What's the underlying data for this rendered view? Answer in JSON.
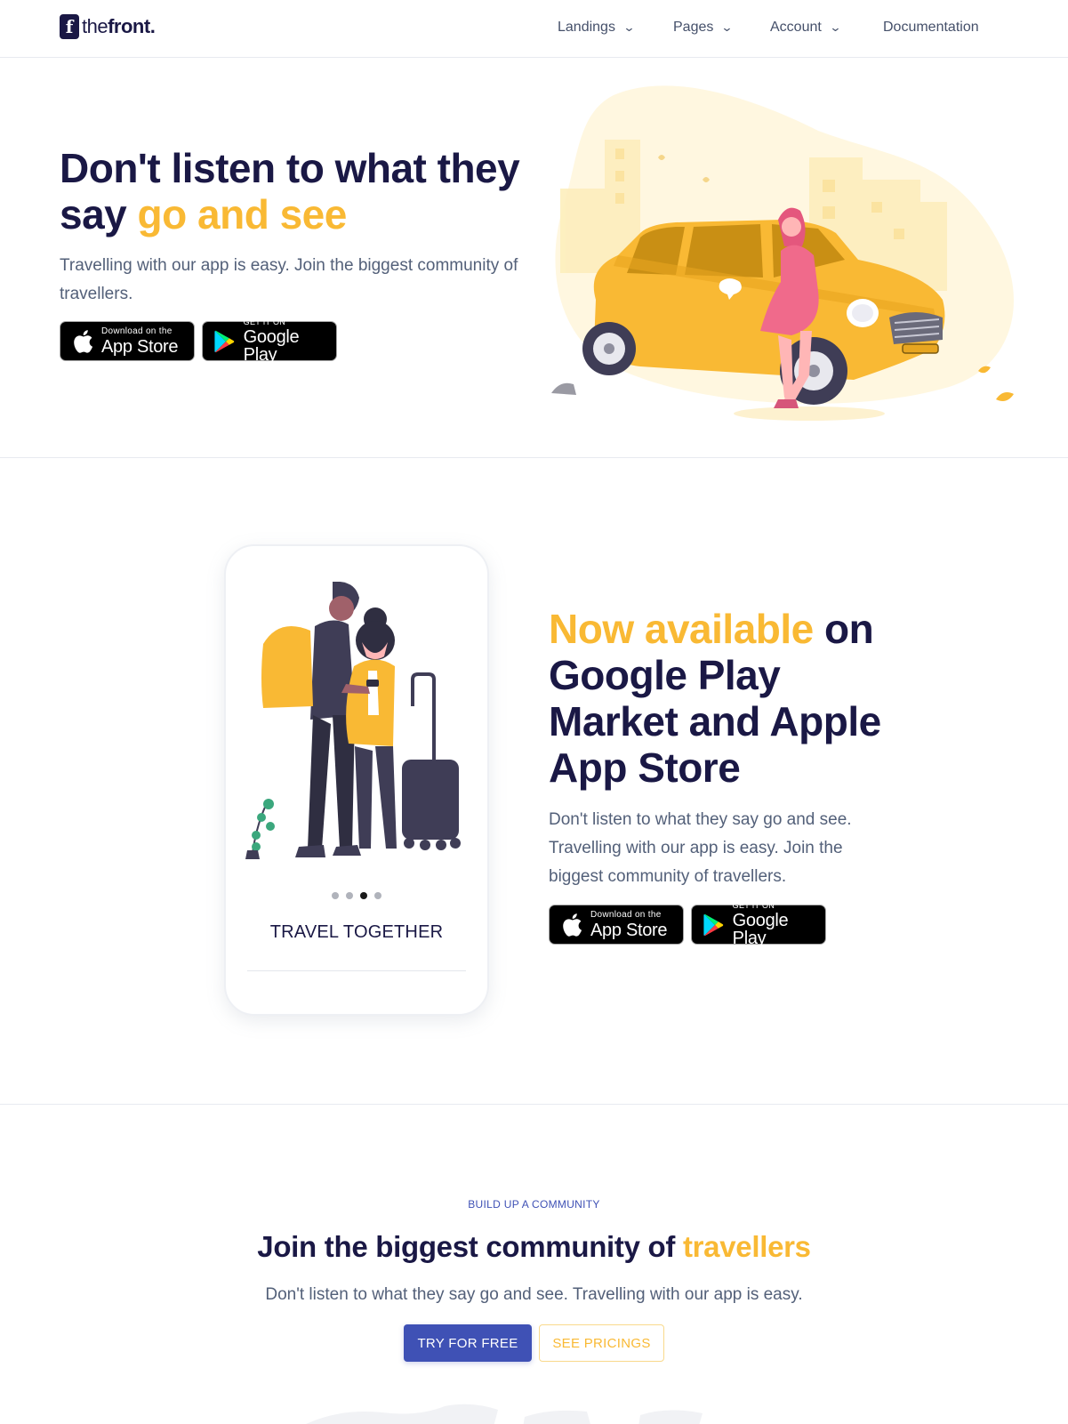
{
  "brand": {
    "logo_letter": "f",
    "name_light": "the",
    "name_bold": "front",
    "name_dot": "."
  },
  "nav": {
    "items": [
      {
        "label": "Landings",
        "has_dropdown": true
      },
      {
        "label": "Pages",
        "has_dropdown": true
      },
      {
        "label": "Account",
        "has_dropdown": true
      },
      {
        "label": "Documentation",
        "has_dropdown": false
      }
    ],
    "dropdown_icon": "chevron-down-icon"
  },
  "hero": {
    "title_main": "Don't listen to what they say ",
    "title_accent": "go and see",
    "subtitle": "Travelling with our app is easy. Join the biggest community of travellers.",
    "illustration": "woman-leaning-on-yellow-car"
  },
  "stores": {
    "apple": {
      "small": "Download on the",
      "big": "App Store",
      "icon": "apple-icon"
    },
    "google": {
      "small": "GET IT ON",
      "big": "Google Play",
      "icon": "google-play-icon"
    }
  },
  "showcase": {
    "phone_caption": "TRAVEL TOGETHER",
    "illustration": "travelling-couple-with-suitcase",
    "carousel": {
      "count": 4,
      "active_index": 2
    },
    "title_accent": "Now available",
    "title_main": " on Google Play Market and Apple App Store",
    "subtitle": "Don't listen to what they say go and see. Travelling with our app is easy. Join the biggest community of travellers."
  },
  "community": {
    "eyebrow": "BUILD UP A COMMUNITY",
    "title_main": "Join the biggest community of ",
    "title_accent": "travellers",
    "subtitle": "Don't listen to what they say go and see. Travelling with our app is easy.",
    "primary_button": "TRY FOR FREE",
    "secondary_button": "SEE PRICINGS"
  },
  "colors": {
    "primary": "#3f51b5",
    "accent": "#f9b934",
    "heading": "#1a1845",
    "body_text": "#536079"
  }
}
